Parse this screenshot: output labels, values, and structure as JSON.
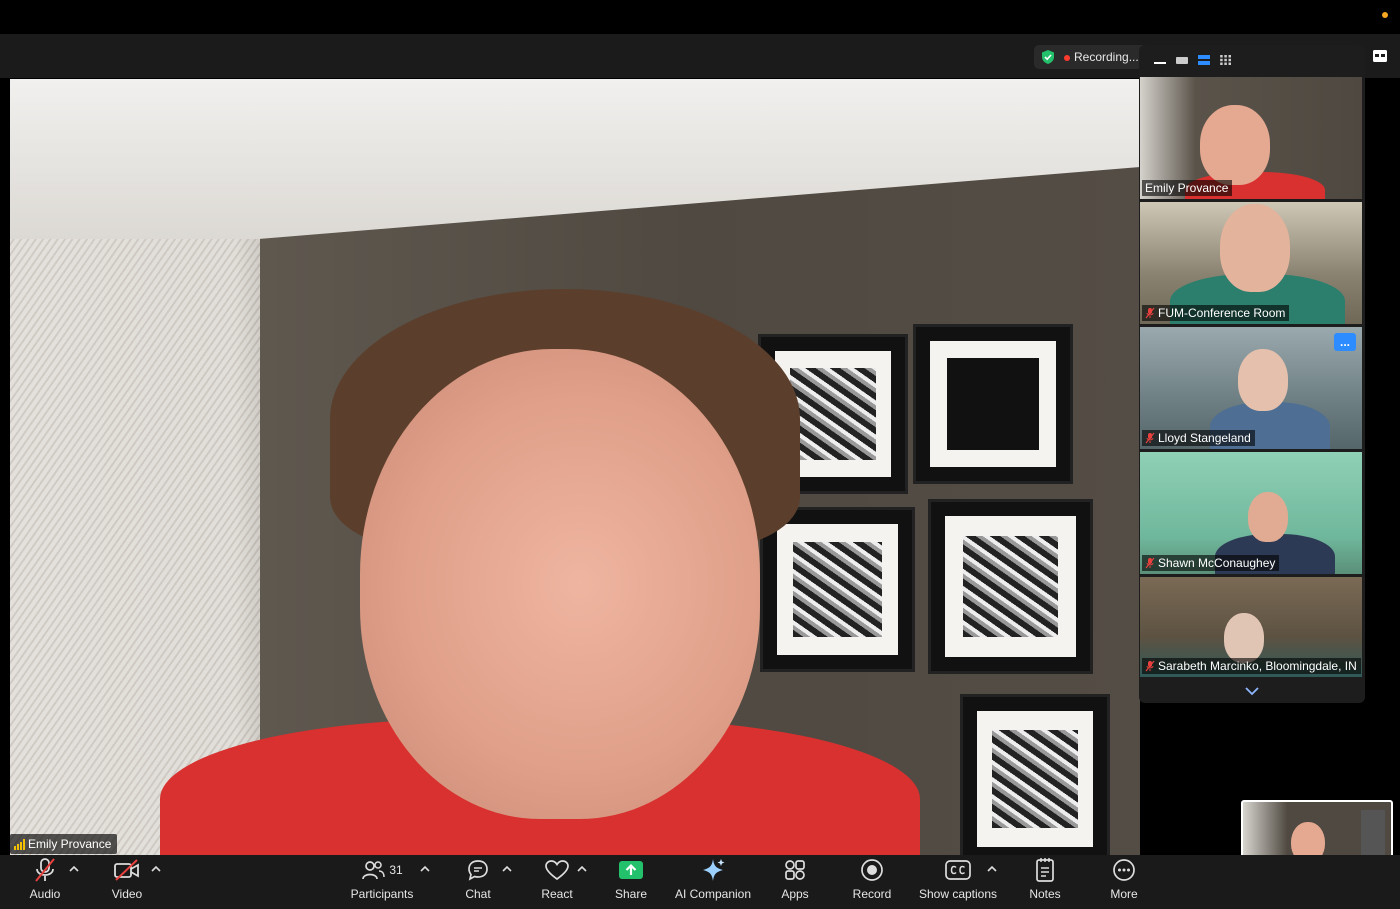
{
  "recording": {
    "label": "Recording..."
  },
  "main_video": {
    "speaker_name": "Emily Provance"
  },
  "gallery": {
    "tiles": [
      {
        "name": "Emily Provance",
        "muted": false,
        "active": true
      },
      {
        "name": "FUM-Conference Room",
        "muted": true,
        "active": false
      },
      {
        "name": "Lloyd Stangeland",
        "muted": true,
        "active": false,
        "more_label": "..."
      },
      {
        "name": "Shawn McConaughey",
        "muted": true,
        "active": false
      },
      {
        "name": "Sarabeth Marcinko, Bloomingdale, IN",
        "muted": true,
        "active": false
      }
    ]
  },
  "toolbar": {
    "audio": "Audio",
    "video": "Video",
    "participants": "Participants",
    "participants_count": "31",
    "chat": "Chat",
    "react": "React",
    "share": "Share",
    "ai_companion": "AI Companion",
    "apps": "Apps",
    "record": "Record",
    "show_captions": "Show captions",
    "notes": "Notes",
    "more": "More"
  },
  "colors": {
    "active_speaker_border": "#4cd964",
    "share_green": "#23c16b",
    "muted_red": "#e8413e",
    "recording_red": "#ff3b30",
    "accent_blue": "#2d8cff"
  }
}
